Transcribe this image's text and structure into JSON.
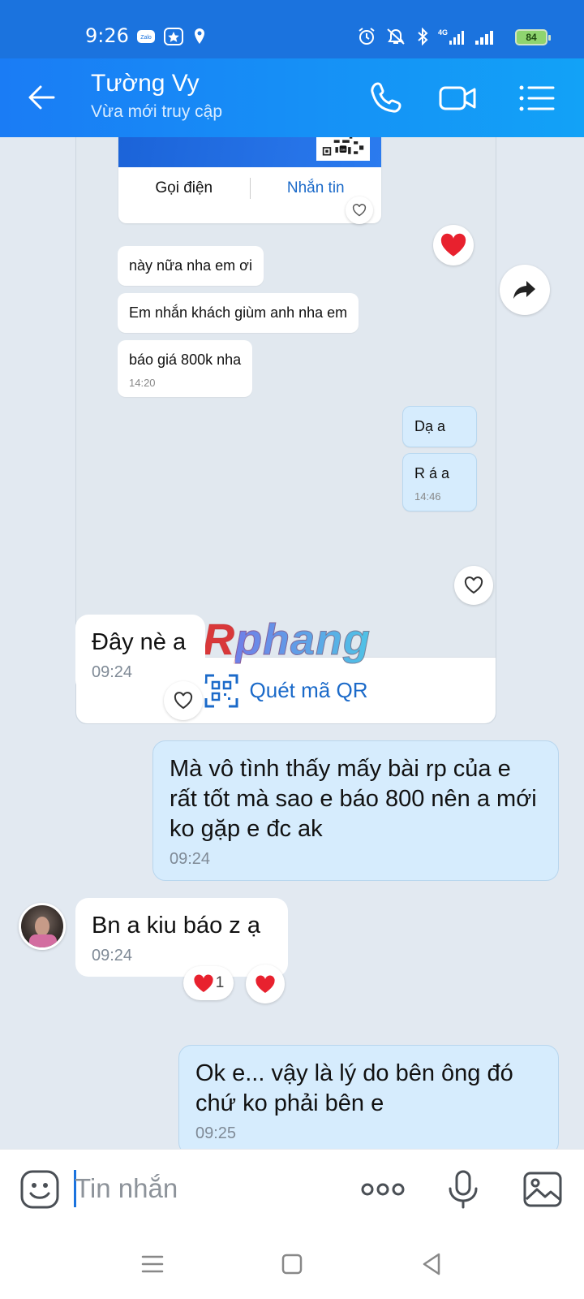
{
  "status_bar": {
    "time": "9:26",
    "battery": "84",
    "network": "4G"
  },
  "header": {
    "contact_name": "Tường Vy",
    "contact_status": "Vừa mới truy cập"
  },
  "quoted": {
    "card_call": "Gọi điện",
    "card_message": "Nhắn tin",
    "messages": [
      {
        "text": "này nữa nha em ơi"
      },
      {
        "text": "Em nhắn khách giùm anh nha em"
      },
      {
        "text": "báo giá 800k nha",
        "time": "14:20"
      }
    ],
    "my_messages": [
      {
        "text": "Dạ a"
      },
      {
        "text": "R á a",
        "time": "14:46"
      }
    ],
    "scan_qr": "Quét mã QR"
  },
  "messages": [
    {
      "text": "Đây nè a",
      "time": "09:24"
    },
    {
      "text": "Mà vô tình thấy mấy bài rp của e rất tốt mà sao e báo 800 nên a mới ko gặp e đc ak",
      "time": "09:24"
    },
    {
      "text": "Bn a kiu báo z ạ",
      "time": "09:24",
      "reaction_count": "1"
    },
    {
      "text": "Ok e... vậy là lý do bên ông đó chứ ko phải bên e",
      "time": "09:25"
    }
  ],
  "watermark": {
    "first": "R",
    "rest": "phang"
  },
  "input": {
    "placeholder": "Tin nhắn"
  },
  "colors": {
    "accent": "#1b73de",
    "my_bubble": "#d6ecfd",
    "background": "#e2e9f1",
    "heart": "#e8212e"
  }
}
